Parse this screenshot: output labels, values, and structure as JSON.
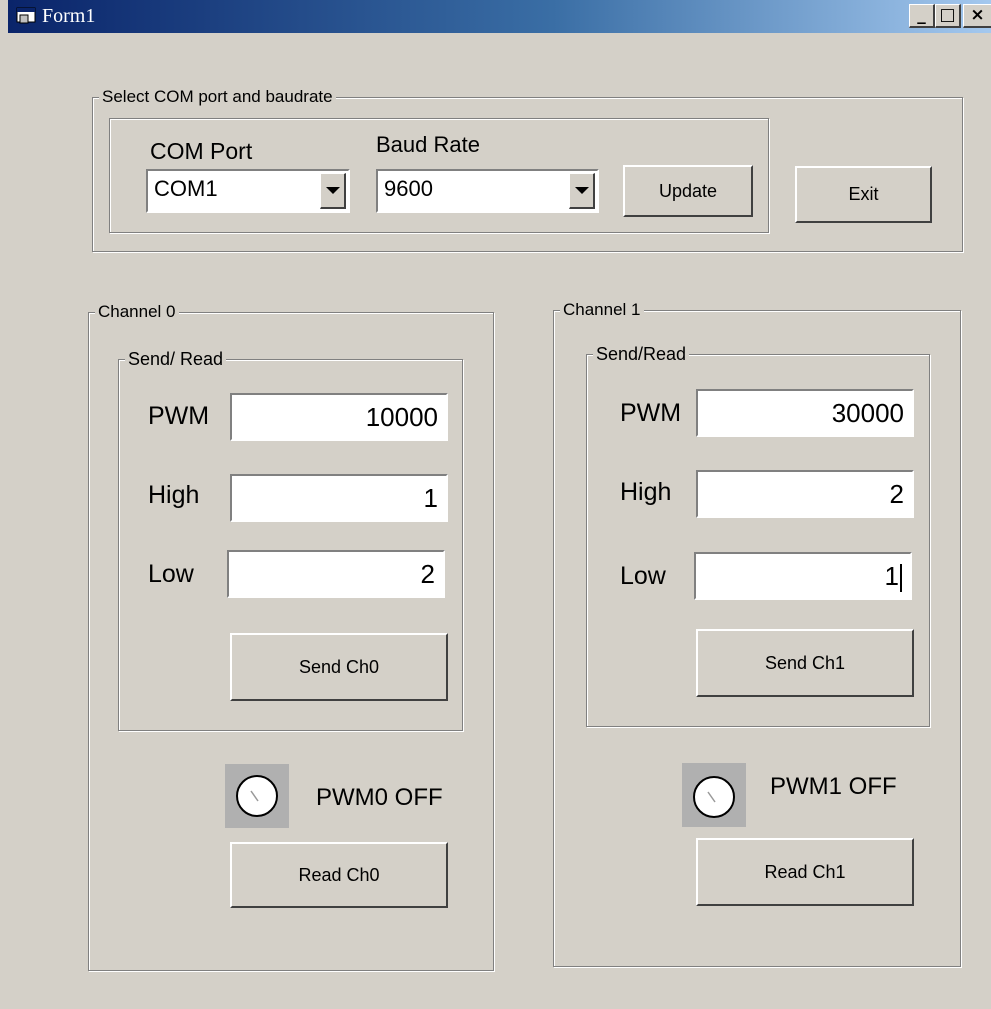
{
  "window": {
    "title": "Form1",
    "controls": {
      "minimize": "_",
      "maximize": "□",
      "close": "×"
    }
  },
  "com_group": {
    "title": "Select COM port and baudrate",
    "com_port_label": "COM Port",
    "com_port_value": "COM1",
    "baud_rate_label": "Baud Rate",
    "baud_rate_value": "9600",
    "update_label": "Update"
  },
  "exit_label": "Exit",
  "channel0": {
    "title": "Channel 0",
    "send_read_title": "Send/ Read",
    "pwm_label": "PWM",
    "pwm_value": "10000",
    "high_label": "High",
    "high_value": "1",
    "low_label": "Low",
    "low_value": "2",
    "send_label": "Send Ch0",
    "status_label": "PWM0 OFF",
    "read_label": "Read Ch0"
  },
  "channel1": {
    "title": "Channel 1",
    "send_read_title": "Send/Read",
    "pwm_label": "PWM",
    "pwm_value": "30000",
    "high_label": "High",
    "high_value": "2",
    "low_label": "Low",
    "low_value": "1",
    "send_label": "Send Ch1",
    "status_label": "PWM1 OFF",
    "read_label": "Read Ch1"
  }
}
